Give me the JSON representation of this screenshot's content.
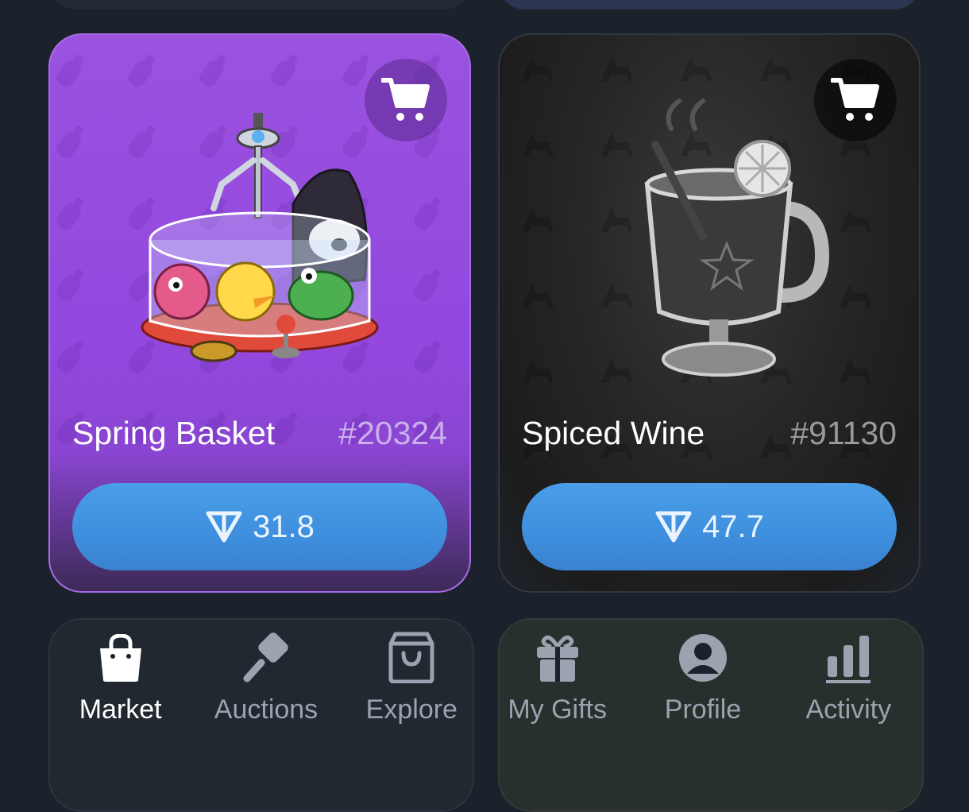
{
  "gifts": [
    {
      "name": "Spring Basket",
      "number": "#20324",
      "price": "31.8",
      "theme_color": "#9348de"
    },
    {
      "name": "Spiced Wine",
      "number": "#91130",
      "price": "47.7",
      "theme_color": "#262626"
    }
  ],
  "nav": [
    {
      "label": "Market",
      "icon": "shopping-bag-icon",
      "active": true
    },
    {
      "label": "Auctions",
      "icon": "gavel-icon",
      "active": false
    },
    {
      "label": "Explore",
      "icon": "store-bag-icon",
      "active": false
    },
    {
      "label": "My Gifts",
      "icon": "gift-icon",
      "active": false
    },
    {
      "label": "Profile",
      "icon": "profile-icon",
      "active": false
    },
    {
      "label": "Activity",
      "icon": "bar-chart-icon",
      "active": false
    }
  ],
  "colors": {
    "background": "#1c222b",
    "price_button": "#4a9ee7",
    "nav_active": "#ffffff",
    "nav_inactive": "#9aa3af"
  }
}
